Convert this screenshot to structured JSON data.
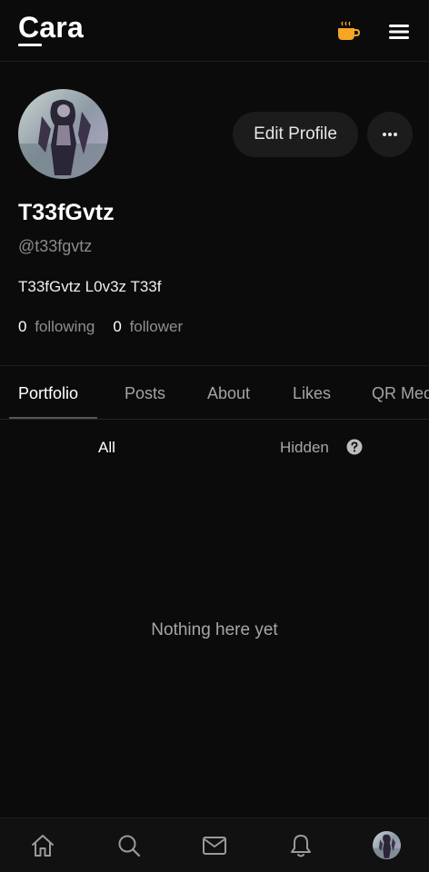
{
  "header": {
    "logo": "Cara",
    "coffee_icon": "coffee-cup-icon",
    "menu_icon": "hamburger-menu-icon",
    "accent_color": "#f5a623"
  },
  "profile": {
    "display_name": "T33fGvtz",
    "handle": "@t33fgvtz",
    "bio": "T33fGvtz L0v3z T33f",
    "following_count": "0",
    "following_label": "following",
    "follower_count": "0",
    "follower_label": "follower",
    "edit_label": "Edit Profile"
  },
  "tabs": {
    "items": [
      {
        "label": "Portfolio",
        "active": true
      },
      {
        "label": "Posts",
        "active": false
      },
      {
        "label": "About",
        "active": false
      },
      {
        "label": "Likes",
        "active": false
      },
      {
        "label": "QR Media",
        "active": false
      }
    ]
  },
  "filters": {
    "all_label": "All",
    "hidden_label": "Hidden"
  },
  "content": {
    "empty_message": "Nothing here yet"
  },
  "bottom_nav": {
    "items": [
      "home-icon",
      "search-icon",
      "mail-icon",
      "bell-icon",
      "profile-avatar"
    ]
  }
}
